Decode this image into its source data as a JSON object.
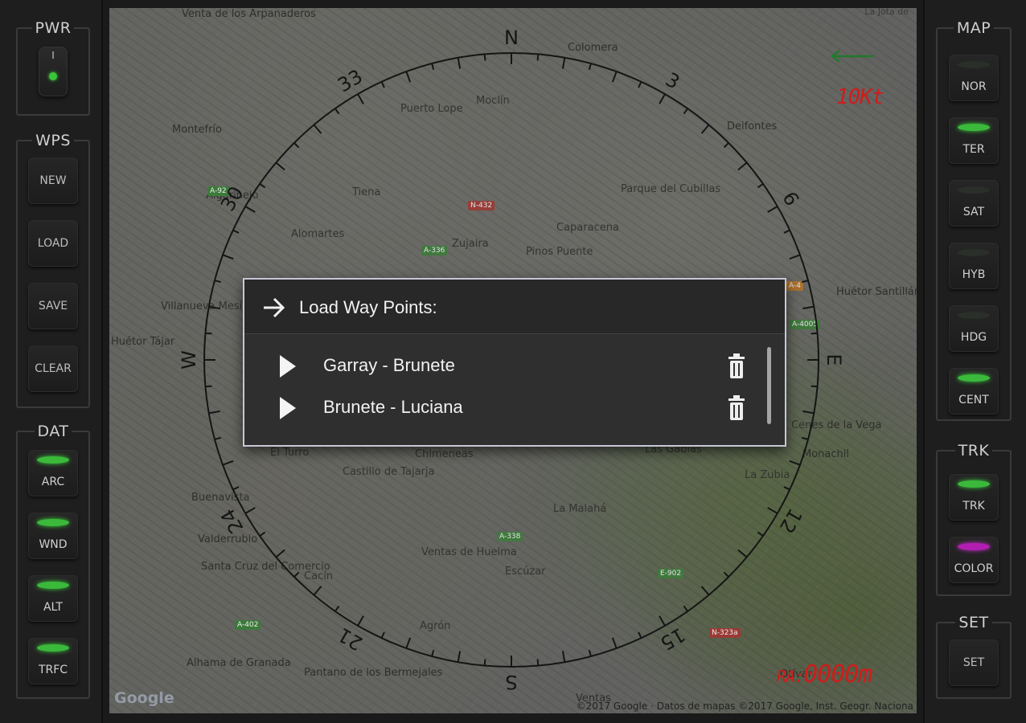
{
  "left_panel": {
    "pwr": {
      "title": "PWR",
      "switch_mark": "I"
    },
    "wps": {
      "title": "WPS",
      "buttons": [
        "NEW",
        "LOAD",
        "SAVE",
        "CLEAR"
      ]
    },
    "dat": {
      "title": "DAT",
      "buttons": [
        "ARC",
        "WND",
        "ALT",
        "TRFC"
      ]
    }
  },
  "right_panel": {
    "map": {
      "title": "MAP",
      "buttons": [
        "NOR",
        "TER",
        "SAT",
        "HYB",
        "HDG",
        "CENT"
      ]
    },
    "trk": {
      "title": "TRK",
      "buttons": [
        "TRK",
        "COLOR"
      ]
    },
    "set": {
      "title": "SET",
      "buttons": [
        "SET"
      ]
    }
  },
  "map": {
    "compass_labels": {
      "N": "N",
      "E": "E",
      "S": "S",
      "W": "W",
      "n3": "3",
      "n6": "6",
      "n12": "12",
      "n15": "15",
      "n21": "21",
      "n24": "24",
      "n30": "30",
      "n33": "33"
    },
    "speed": "10Kt",
    "range_prefix": "RA:",
    "range_value": "0000m",
    "attribution": "©2017 Google · Datos de mapas ©2017 Google, Inst. Geogr. Naciona",
    "google_logo": "Google",
    "top_right_label": "La Jota de",
    "places": [
      "Venta de los Arpanaderos",
      "Colomera",
      "Montefrío",
      "Puerto Lope",
      "Moclín",
      "Deifontes",
      "Tiena",
      "Parque del Cubillas",
      "Caparacena",
      "Algarinejo",
      "Alomartes",
      "Zujaira",
      "Pinos Puente",
      "Huétor Santillán",
      "Villanueva Mesía",
      "Huétor Tájar",
      "Castillo de Tajarja",
      "Chimeneas",
      "Las Gabias",
      "Cenes de la Vega",
      "Monachil",
      "La Zubia",
      "El Turro",
      "Buenavista",
      "La Malahá",
      "Valderrubio",
      "Santa Cruz del Comercio",
      "Cacín",
      "Ventas de Huelma",
      "Escúzar",
      "Agrón",
      "Alhama de Granada",
      "Pantano de los Bermejales",
      "Ventas",
      "Otívar"
    ],
    "roads": [
      "N-432",
      "A-336",
      "A-4",
      "A-4005",
      "A-338",
      "E-902",
      "A-402",
      "N-323a",
      "A-92"
    ]
  },
  "dialog": {
    "title": "Load Way Points:",
    "items": [
      {
        "name": "Garray - Brunete"
      },
      {
        "name": "Brunete - Luciana"
      }
    ]
  },
  "colors": {
    "led_green": "#3bb93b",
    "led_magenta": "#b21eb2",
    "digital_red": "#d01c1c",
    "dialog_bg": "#2f2f2f"
  }
}
